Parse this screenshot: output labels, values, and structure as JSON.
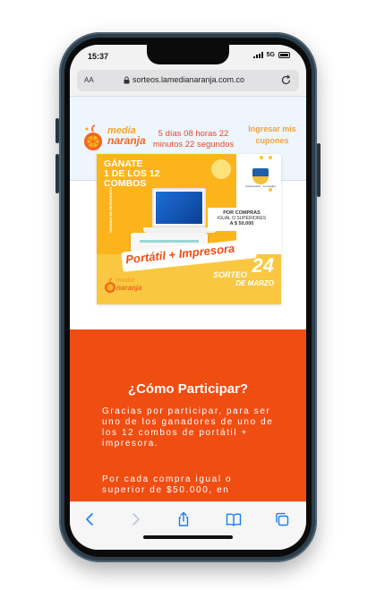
{
  "status_bar": {
    "time": "15:37",
    "network": "5G"
  },
  "address_bar": {
    "text_size_label": "AA",
    "url": "sorteos.lamedianaranja.com.co"
  },
  "header": {
    "logo_line1": "media",
    "logo_line2": "naranja",
    "countdown": "5 días 08 horas 22 minutos 22 segundos",
    "login_link": "Ingresar mis cupones"
  },
  "banner": {
    "headline_line1": "GÁNATE",
    "headline_line2": "1 DE LOS 12",
    "headline_line3": "COMBOS",
    "reference_note": "*IMAGEN DE REFERENCIA",
    "crest_text": "Gobernación · La Guajira",
    "purchase_line1": "POR COMPRAS",
    "purchase_line2": "IGUAL O SUPERIORES",
    "purchase_amount": "A $ 50.000",
    "prize_text": "Portátil + Impresora",
    "draw_label": "SORTEO",
    "draw_day": "24",
    "draw_month": "DE MARZO",
    "logo_line1": "media",
    "logo_line2": "naranja"
  },
  "content": {
    "section_title": "¿Cómo Participar?",
    "paragraph1": "Gracias por participar, para ser uno de los ganadores de uno de los 12 combos de portátil + impresora.",
    "paragraph2": "Por cada compra igual o superior de $50.000, en"
  },
  "colors": {
    "brand_orange": "#f04d12",
    "brand_yellow": "#fbb41c",
    "header_bg": "#eef5fc"
  },
  "toolbar": {
    "back_icon": "back-chevron-icon",
    "forward_icon": "forward-chevron-icon",
    "share_icon": "share-icon",
    "bookmarks_icon": "book-icon",
    "tabs_icon": "tabs-icon"
  }
}
